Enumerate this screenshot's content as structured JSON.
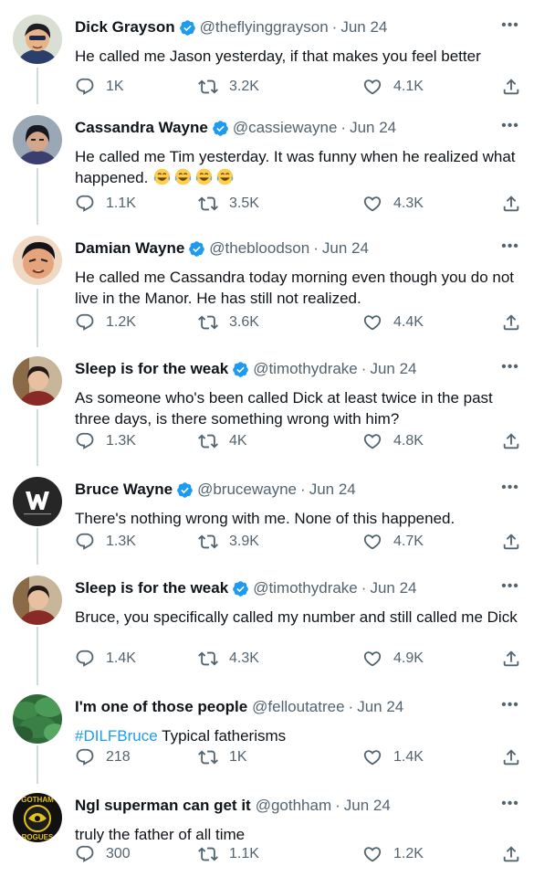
{
  "colors": {
    "accent": "#1d9bf0",
    "text": "#0f1419",
    "secondary": "#536471",
    "thread_line": "#cfd9de"
  },
  "tweets": [
    {
      "name": "Dick Grayson",
      "verified": true,
      "handle": "@theflyinggrayson",
      "separator": "·",
      "date": "Jun 24",
      "text": "He called me Jason yesterday, if that makes you feel better",
      "replies": "1K",
      "retweets": "3.2K",
      "likes": "4.1K",
      "avatar_icon": "avatar-dick-grayson"
    },
    {
      "name": "Cassandra Wayne",
      "verified": true,
      "handle": "@cassiewayne",
      "separator": "·",
      "date": "Jun 24",
      "text": "He called me Tim yesterday. It was funny when he realized what happened.",
      "emoji_icon": "tears-of-joy-emoji",
      "emoji_count": 4,
      "replies": "1.1K",
      "retweets": "3.5K",
      "likes": "4.3K",
      "avatar_icon": "avatar-cassandra-wayne"
    },
    {
      "name": "Damian Wayne",
      "verified": true,
      "handle": "@thebloodson",
      "separator": "·",
      "date": "Jun 24",
      "text": "He called me Cassandra today morning even though you do not live in the Manor. He has still not realized.",
      "replies": "1.2K",
      "retweets": "3.6K",
      "likes": "4.4K",
      "avatar_icon": "avatar-damian-wayne"
    },
    {
      "name": "Sleep is for the weak",
      "verified": true,
      "handle": "@timothydrake",
      "separator": "·",
      "date": "Jun 24",
      "text": "As someone who's been called Dick at least twice in the past three days, is there something wrong with him?",
      "replies": "1.3K",
      "retweets": "4K",
      "likes": "4.8K",
      "avatar_icon": "avatar-tim-drake"
    },
    {
      "name": "Bruce Wayne",
      "verified": true,
      "handle": "@brucewayne",
      "separator": "·",
      "date": "Jun 24",
      "text": "There's nothing wrong with me. None of this happened.",
      "replies": "1.3K",
      "retweets": "3.9K",
      "likes": "4.7K",
      "avatar_icon": "wayne-enterprises-logo"
    },
    {
      "name": "Sleep is for the weak",
      "verified": true,
      "handle": "@timothydrake",
      "separator": "·",
      "date": "Jun 24",
      "text": "Bruce, you specifically called my number and still called me Dick",
      "replies": "1.4K",
      "retweets": "4.3K",
      "likes": "4.9K",
      "avatar_icon": "avatar-tim-drake"
    },
    {
      "name": "I'm one of those people",
      "verified": false,
      "handle": "@felloutatree",
      "separator": "·",
      "date": "Jun 24",
      "hashtag": "#DILFBruce",
      "text": " Typical fatherisms",
      "replies": "218",
      "retweets": "1K",
      "likes": "1.4K",
      "avatar_icon": "avatar-green-leaves"
    },
    {
      "name": "Ngl superman can get it",
      "verified": false,
      "handle": "@gothham",
      "separator": "·",
      "date": "Jun 24",
      "text": "truly the father of all time",
      "replies": "300",
      "retweets": "1.1K",
      "likes": "1.2K",
      "avatar_icon": "gotham-rogues-logo",
      "avatar_text_top": "GOTHAM",
      "avatar_text_bottom": "ROGUES"
    }
  ],
  "more_icon_label": "•••"
}
